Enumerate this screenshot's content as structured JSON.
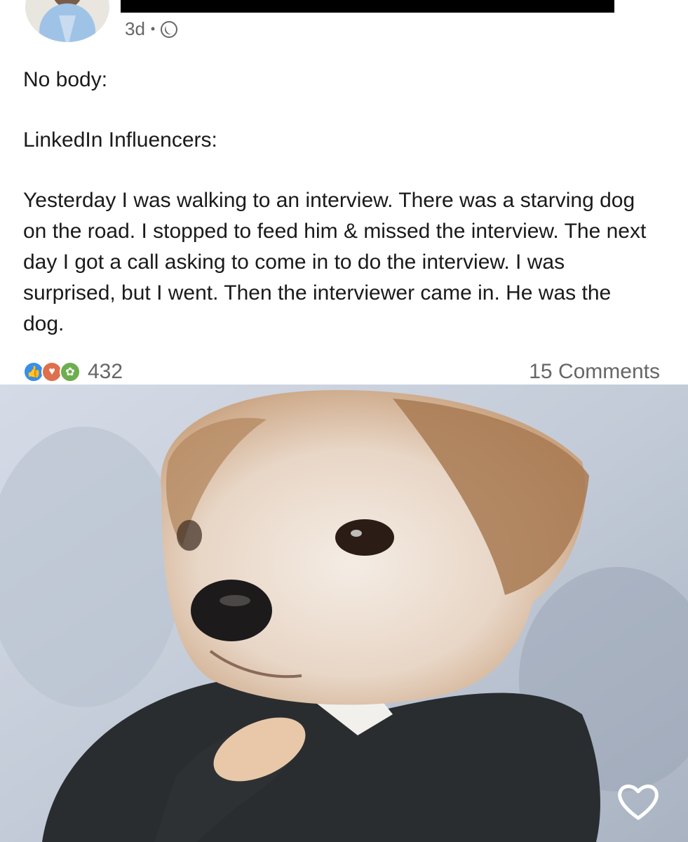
{
  "post": {
    "time": "3d",
    "separator": "•",
    "visibility_icon": "globe-icon",
    "lines": [
      "No body:",
      "LinkedIn Influencers:",
      "Yesterday I was walking to an interview. There was a starving dog on the road. I stopped to feed him & missed the interview. The next day I got a call asking to come in to do the interview. I was surprised, but I went. Then the interviewer came in. He was the dog."
    ]
  },
  "social": {
    "reaction_icons": [
      "like-icon",
      "love-icon",
      "clap-icon"
    ],
    "reaction_count": "432",
    "comments": "15 Comments"
  },
  "image": {
    "subject": "dog-in-suit-icon",
    "favorite_icon": "heart-outline-icon"
  },
  "colors": {
    "like": "#378fe9",
    "love": "#df704d",
    "clap": "#6dae4f"
  }
}
